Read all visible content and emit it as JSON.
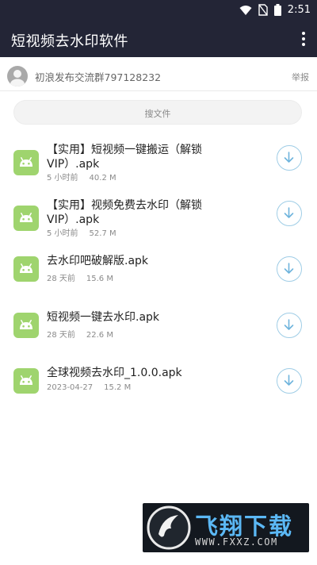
{
  "status_bar": {
    "time": "2:51"
  },
  "app_bar": {
    "title": "短视频去水印软件"
  },
  "user_bar": {
    "group_text": "初浪发布交流群797128232",
    "report_label": "举报"
  },
  "search": {
    "placeholder": "搜文件"
  },
  "files": [
    {
      "name_line1": "【实用】短视频一键搬运（解锁",
      "name_line2": "VIP）.apk",
      "time": "5 小时前",
      "size": "40.2 M"
    },
    {
      "name_line1": "【实用】视频免费去水印（解锁",
      "name_line2": "VIP）.apk",
      "time": "5 小时前",
      "size": "52.7 M"
    },
    {
      "name_line1": "去水印吧破解版.apk",
      "name_line2": "",
      "time": "28 天前",
      "size": "15.6 M"
    },
    {
      "name_line1": "短视频一键去水印.apk",
      "name_line2": "",
      "time": "28 天前",
      "size": "22.6 M"
    },
    {
      "name_line1": "全球视频去水印_1.0.0.apk",
      "name_line2": "",
      "time": "2023-04-27",
      "size": "15.2 M"
    }
  ],
  "watermark": {
    "brand": "飞翔下载",
    "url": "WWW.FXXZ.COM"
  },
  "colors": {
    "app_bar": "#232536",
    "android_icon": "#9fd46e",
    "download_ring": "#9fcde6",
    "download_arrow": "#6fb4dc"
  }
}
